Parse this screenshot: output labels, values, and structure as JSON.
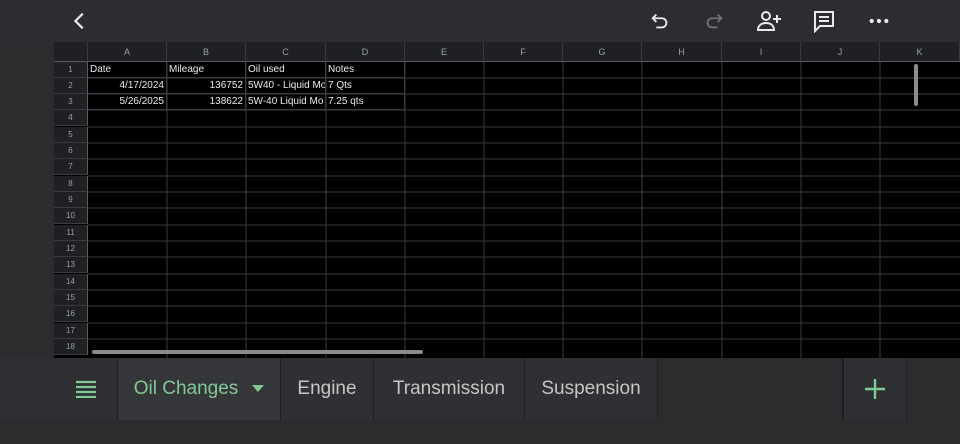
{
  "toolbar": {
    "back_icon": "chevron-left-icon",
    "undo_icon": "undo-icon",
    "redo_icon": "redo-icon",
    "share_icon": "add-person-icon",
    "comment_icon": "comment-icon",
    "more_icon": "more-horiz-icon"
  },
  "columns": [
    "A",
    "B",
    "C",
    "D",
    "E",
    "F",
    "G",
    "H",
    "I",
    "J",
    "K"
  ],
  "rows": [
    "1",
    "2",
    "3",
    "4",
    "5",
    "6",
    "7",
    "8",
    "9",
    "10",
    "11",
    "12",
    "13",
    "14",
    "15",
    "16",
    "17",
    "18"
  ],
  "cells": {
    "r1": [
      "Date",
      "Mileage",
      "Oil used",
      "Notes"
    ],
    "r2": [
      "4/17/2024",
      "136752",
      "5W40 - Liquid Mo",
      "7 Qts"
    ],
    "r3": [
      "5/26/2025",
      "138622",
      "5W-40 Liquid Mo",
      "7.25 qts"
    ]
  },
  "tabs": {
    "menu_icon": "sheets-list-icon",
    "items": [
      "Oil Changes",
      "Engine",
      "Transmission",
      "Suspension"
    ],
    "active_dropdown_icon": "caret-down-icon",
    "add_icon": "plus-icon"
  },
  "colors": {
    "accent": "#81c995",
    "background": "#000000",
    "chrome": "#2b2c2e"
  }
}
